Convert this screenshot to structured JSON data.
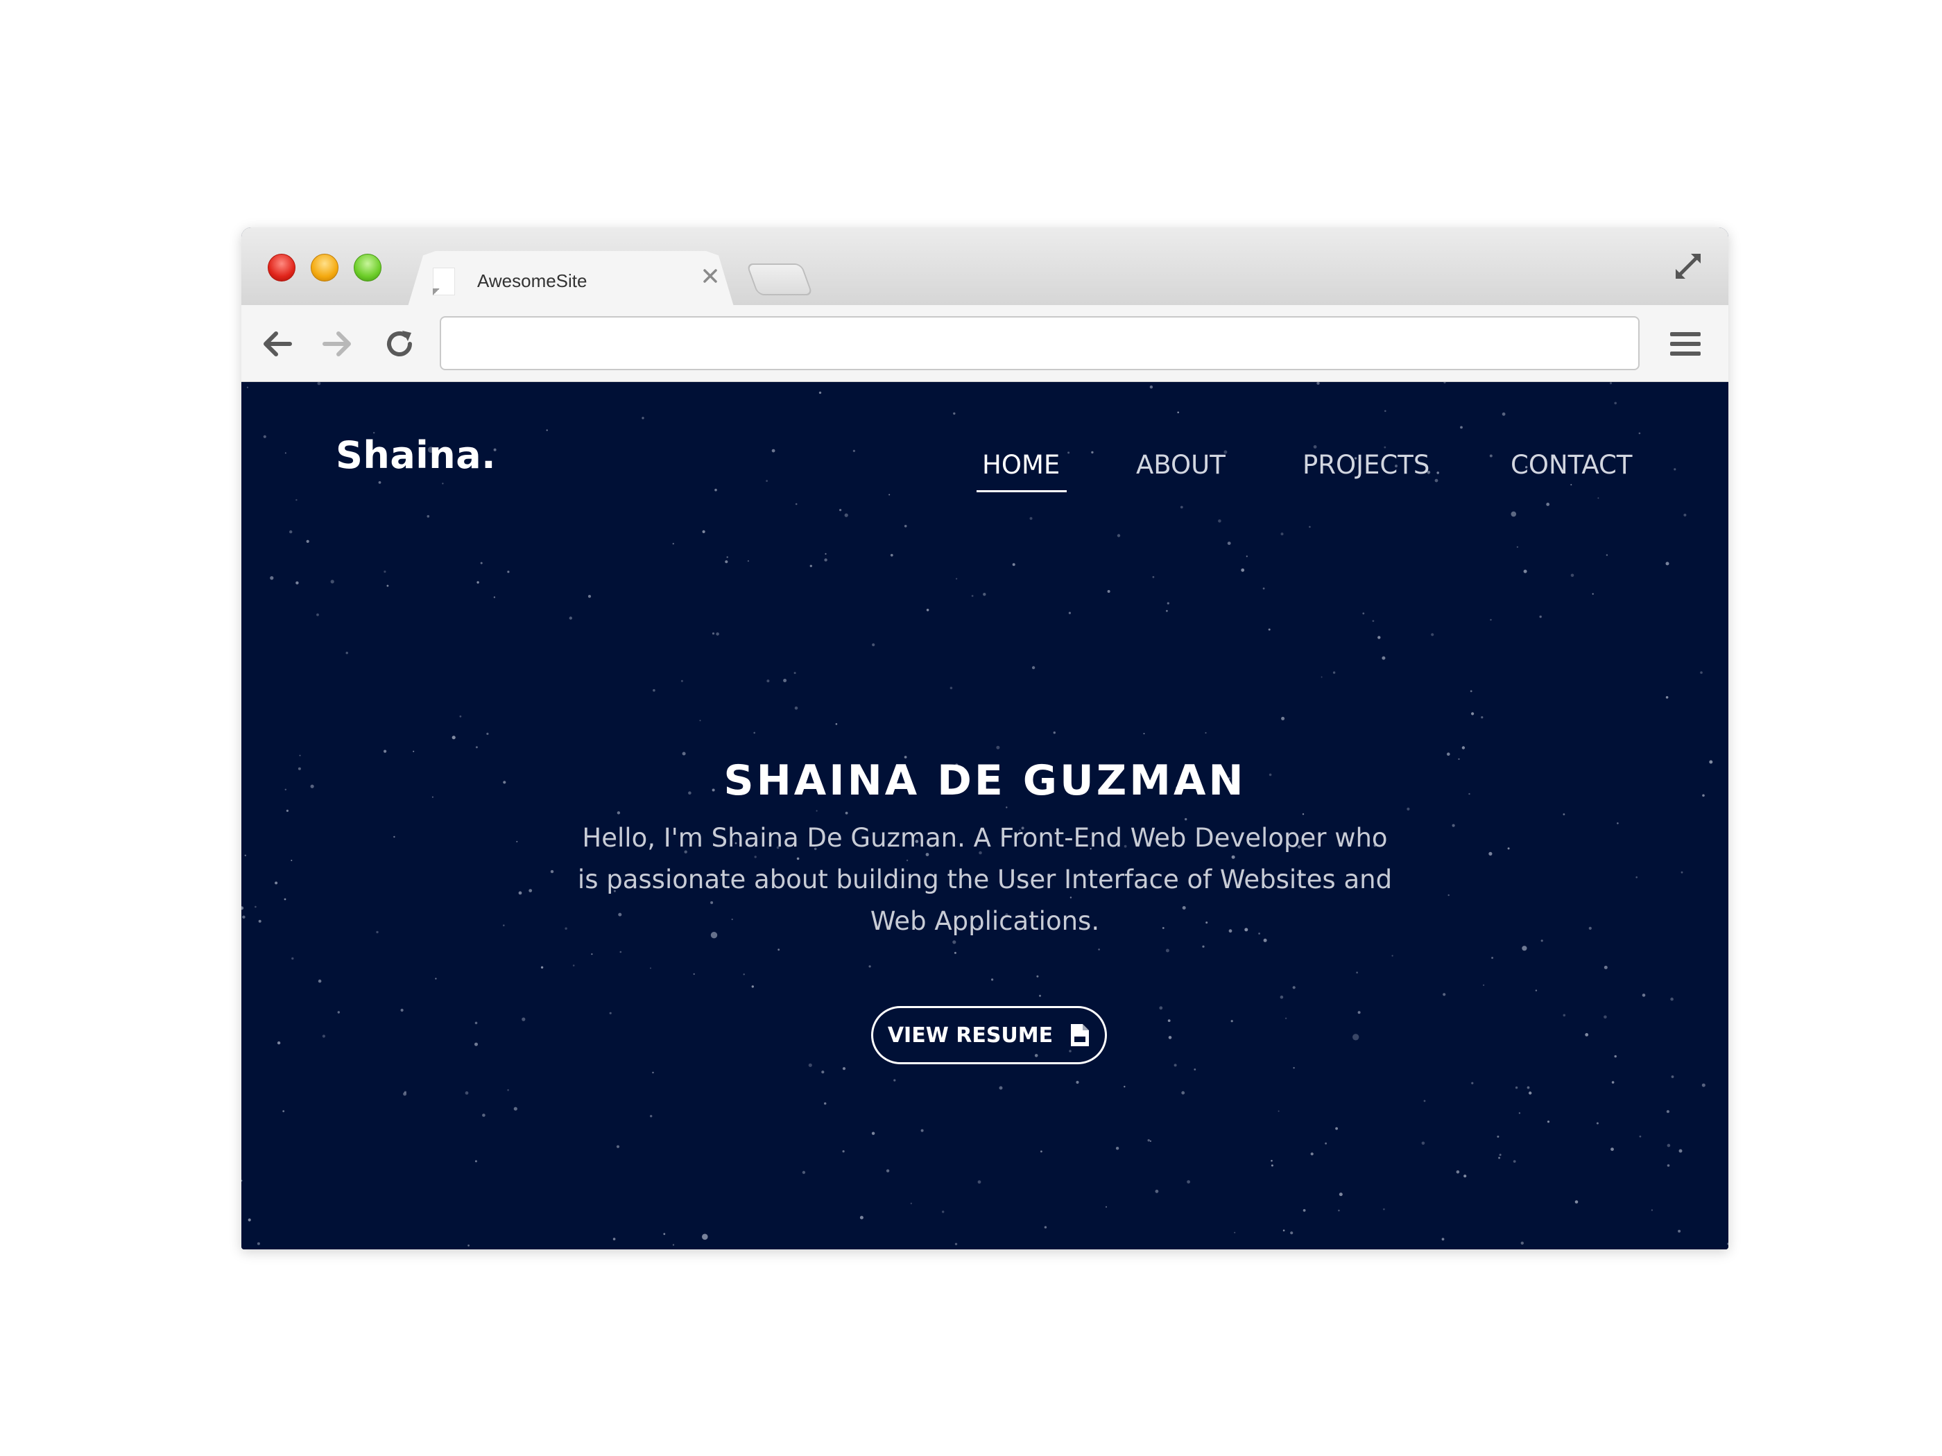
{
  "browser": {
    "tab_title": "AwesomeSite",
    "address_value": "",
    "address_placeholder": ""
  },
  "site": {
    "logo": "Shaina.",
    "nav": [
      {
        "label": "HOME",
        "active": true
      },
      {
        "label": "ABOUT",
        "active": false
      },
      {
        "label": "PROJECTS",
        "active": false
      },
      {
        "label": "CONTACT",
        "active": false
      }
    ],
    "hero": {
      "title": "SHAINA DE GUZMAN",
      "text": "Hello, I'm Shaina De Guzman. A Front-End Web Developer who is passionate about building the User Interface of Websites and Web Applications.",
      "button_label": "VIEW RESUME",
      "button_icon": "pdf-file-icon"
    }
  },
  "colors": {
    "page_background": "#001036",
    "text": "#ffffff",
    "nav_inactive": "#d2d6e0"
  }
}
